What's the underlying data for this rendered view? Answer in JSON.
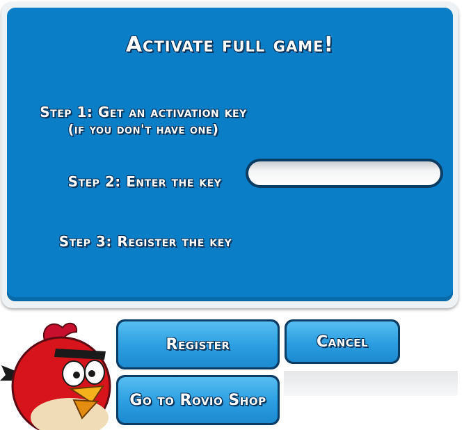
{
  "dialog": {
    "title": "Activate full game!",
    "step1": "Step 1: Get an activation key",
    "step1_sub": "(if you don't have one)",
    "step2": "Step 2: Enter the key",
    "step3": "Step 3: Register the key",
    "key_value": ""
  },
  "buttons": {
    "register": "Register",
    "cancel": "Cancel",
    "shop": "Go to Rovio Shop"
  },
  "mascot": {
    "icon": "red-bird-icon"
  },
  "colors": {
    "panel_blue": "#0a7ec6",
    "button_blue": "#2b9ee0",
    "outline": "#0b3c63"
  }
}
